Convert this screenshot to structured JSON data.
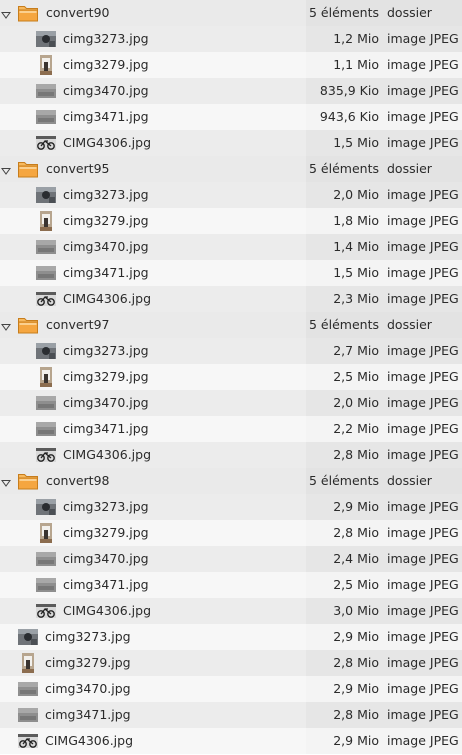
{
  "colors": {
    "folder_body": "#f5a640",
    "folder_tab": "#f7b95e",
    "row_odd": "#f4f4f4",
    "row_even": "#e6e6e6",
    "text": "#2b2b2b"
  },
  "folders": [
    {
      "name": "convert90",
      "count": "5 éléments",
      "type": "dossier",
      "expanded": true,
      "files": [
        {
          "name": "cimg3273.jpg",
          "size": "1,2 Mio",
          "type": "image JPEG",
          "thumb": "dark-photo"
        },
        {
          "name": "cimg3279.jpg",
          "size": "1,1 Mio",
          "type": "image JPEG",
          "thumb": "portrait-photo"
        },
        {
          "name": "cimg3470.jpg",
          "size": "835,9 Kio",
          "type": "image JPEG",
          "thumb": "gray-photo"
        },
        {
          "name": "cimg3471.jpg",
          "size": "943,6 Kio",
          "type": "image JPEG",
          "thumb": "gray-photo"
        },
        {
          "name": "CIMG4306.jpg",
          "size": "1,5 Mio",
          "type": "image JPEG",
          "thumb": "bike-photo"
        }
      ]
    },
    {
      "name": "convert95",
      "count": "5 éléments",
      "type": "dossier",
      "expanded": true,
      "files": [
        {
          "name": "cimg3273.jpg",
          "size": "2,0 Mio",
          "type": "image JPEG",
          "thumb": "dark-photo"
        },
        {
          "name": "cimg3279.jpg",
          "size": "1,8 Mio",
          "type": "image JPEG",
          "thumb": "portrait-photo"
        },
        {
          "name": "cimg3470.jpg",
          "size": "1,4 Mio",
          "type": "image JPEG",
          "thumb": "gray-photo"
        },
        {
          "name": "cimg3471.jpg",
          "size": "1,5 Mio",
          "type": "image JPEG",
          "thumb": "gray-photo"
        },
        {
          "name": "CIMG4306.jpg",
          "size": "2,3 Mio",
          "type": "image JPEG",
          "thumb": "bike-photo"
        }
      ]
    },
    {
      "name": "convert97",
      "count": "5 éléments",
      "type": "dossier",
      "expanded": true,
      "files": [
        {
          "name": "cimg3273.jpg",
          "size": "2,7 Mio",
          "type": "image JPEG",
          "thumb": "dark-photo"
        },
        {
          "name": "cimg3279.jpg",
          "size": "2,5 Mio",
          "type": "image JPEG",
          "thumb": "portrait-photo"
        },
        {
          "name": "cimg3470.jpg",
          "size": "2,0 Mio",
          "type": "image JPEG",
          "thumb": "gray-photo"
        },
        {
          "name": "cimg3471.jpg",
          "size": "2,2 Mio",
          "type": "image JPEG",
          "thumb": "gray-photo"
        },
        {
          "name": "CIMG4306.jpg",
          "size": "2,8 Mio",
          "type": "image JPEG",
          "thumb": "bike-photo"
        }
      ]
    },
    {
      "name": "convert98",
      "count": "5 éléments",
      "type": "dossier",
      "expanded": true,
      "files": [
        {
          "name": "cimg3273.jpg",
          "size": "2,9 Mio",
          "type": "image JPEG",
          "thumb": "dark-photo"
        },
        {
          "name": "cimg3279.jpg",
          "size": "2,8 Mio",
          "type": "image JPEG",
          "thumb": "portrait-photo"
        },
        {
          "name": "cimg3470.jpg",
          "size": "2,4 Mio",
          "type": "image JPEG",
          "thumb": "gray-photo"
        },
        {
          "name": "cimg3471.jpg",
          "size": "2,5 Mio",
          "type": "image JPEG",
          "thumb": "gray-photo"
        },
        {
          "name": "CIMG4306.jpg",
          "size": "3,0 Mio",
          "type": "image JPEG",
          "thumb": "bike-photo"
        }
      ]
    }
  ],
  "root_files": [
    {
      "name": "cimg3273.jpg",
      "size": "2,9 Mio",
      "type": "image JPEG",
      "thumb": "dark-photo"
    },
    {
      "name": "cimg3279.jpg",
      "size": "2,8 Mio",
      "type": "image JPEG",
      "thumb": "portrait-photo"
    },
    {
      "name": "cimg3470.jpg",
      "size": "2,9 Mio",
      "type": "image JPEG",
      "thumb": "gray-photo"
    },
    {
      "name": "cimg3471.jpg",
      "size": "2,8 Mio",
      "type": "image JPEG",
      "thumb": "gray-photo"
    },
    {
      "name": "CIMG4306.jpg",
      "size": "2,9 Mio",
      "type": "image JPEG",
      "thumb": "bike-photo"
    }
  ]
}
